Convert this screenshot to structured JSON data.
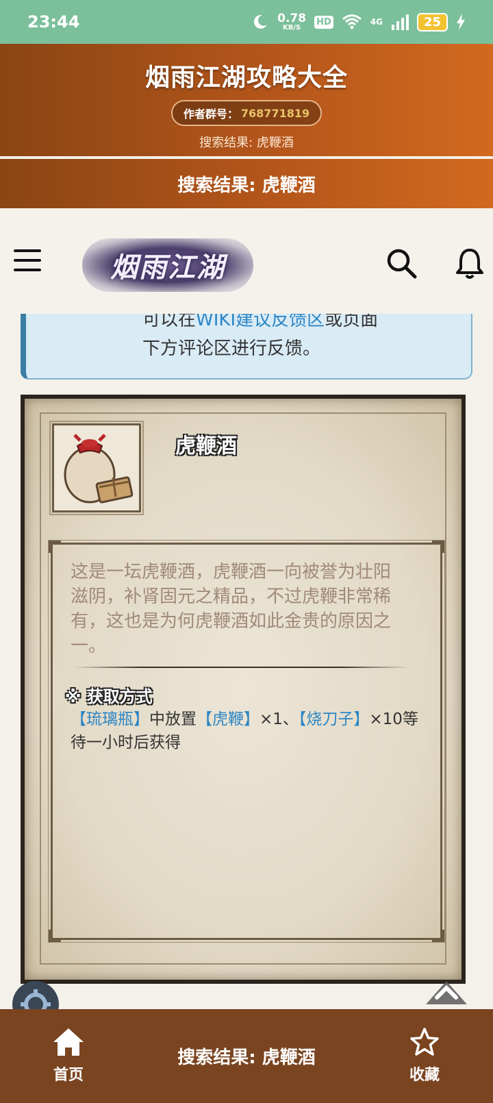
{
  "status_bar": {
    "time": "23:44",
    "net_speed": "0.78",
    "net_unit": "KB/S",
    "hd": "HD",
    "network": "4G",
    "battery": "25"
  },
  "header": {
    "title": "烟雨江湖攻略大全",
    "group_label": "作者群号：",
    "group_number": "768771819",
    "subtitle": "搜索结果: 虎鞭酒"
  },
  "title_bar": "搜索结果: 虎鞭酒",
  "site_nav": {
    "logo_text": "烟雨江湖",
    "menu_icon": "hamburger-icon",
    "search_icon": "search-icon",
    "bell_icon": "bell-icon"
  },
  "notice": {
    "line1_prefix": "可以在",
    "line1_link": "WIKI建议反馈区",
    "line1_suffix": "或页面",
    "line2": "下方评论区进行反馈。"
  },
  "item": {
    "name": "虎鞭酒",
    "description": "这是一坛虎鞭酒，虎鞭酒一向被誉为壮阳滋阴，补肾固元之精品，不过虎鞭非常稀有，这也是为何虎鞭酒如此金贵的原因之一。",
    "acquire_title": "※ 获取方式",
    "acquire": {
      "link1": "【琉璃瓶】",
      "text1": "中放置",
      "link2": "【虎鞭】",
      "text2": "×1、",
      "link3": "【烧刀子】",
      "text3": "×10等待一小时后获得"
    }
  },
  "bottom_nav": {
    "home": "首页",
    "center": "搜索结果: 虎鞭酒",
    "favorites": "收藏"
  },
  "colors": {
    "status_bar": "#7cbf9b",
    "header_start": "#8b4513",
    "header_end": "#d2691e",
    "bottom_nav": "#7a4420",
    "link": "#2b86c5",
    "notice_bg": "#d9ebf5"
  }
}
